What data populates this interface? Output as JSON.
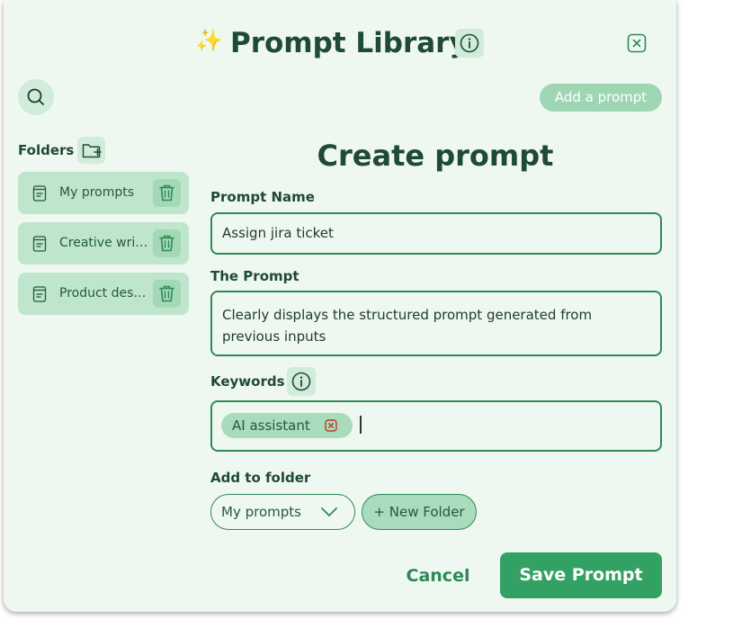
{
  "header": {
    "sparkle_glyph": "✨",
    "title": "Prompt Library"
  },
  "toolbar": {
    "add_prompt_label": "Add a prompt"
  },
  "sidebar": {
    "folders_label": "Folders",
    "folders": [
      {
        "label": "My prompts"
      },
      {
        "label": "Creative writing"
      },
      {
        "label": "Product design"
      }
    ]
  },
  "form": {
    "heading": "Create prompt",
    "prompt_name_label": "Prompt Name",
    "prompt_name_value": "Assign jira ticket",
    "prompt_label": "The Prompt",
    "prompt_value_line1": "Clearly displays the structured prompt generated from",
    "prompt_value_line2": "previous inputs",
    "keywords_label": "Keywords",
    "keywords": [
      "AI assistant"
    ],
    "folder_label": "Add to folder",
    "folder_selected": "My prompts",
    "new_folder_label": "+ New Folder"
  },
  "actions": {
    "cancel_label": "Cancel",
    "save_label": "Save Prompt"
  },
  "colors": {
    "panel_bg": "#eef8f1",
    "accent": "#33a164",
    "dark_text": "#1f4a33",
    "chip_bg": "#a8dcbc",
    "close_red": "#c0392b"
  },
  "icons": [
    "sparkles-icon",
    "info-icon",
    "close-icon",
    "search-icon",
    "folder-add-icon",
    "document-icon",
    "trash-icon",
    "chevron-down-icon"
  ]
}
